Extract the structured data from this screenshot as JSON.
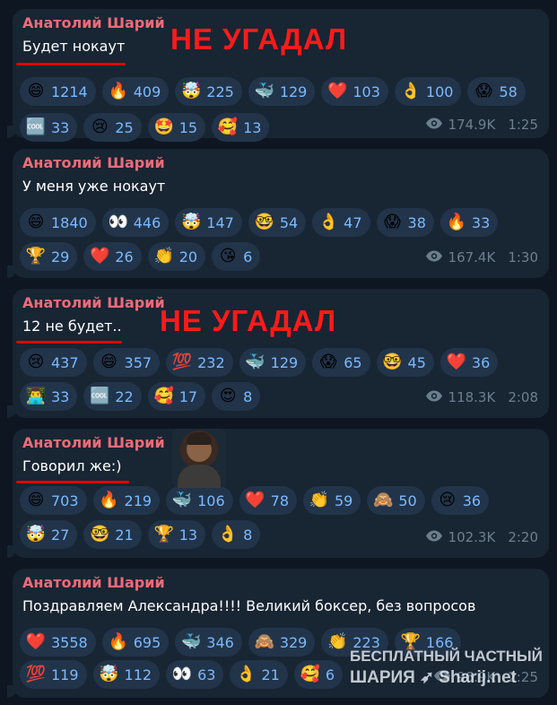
{
  "messages": [
    {
      "sender": "Анатолий Шарий",
      "text": "Будет нокаут",
      "annotation": "НЕ УГАДАЛ",
      "reactions": [
        [
          {
            "emoji": "😄",
            "count": "1214"
          },
          {
            "emoji": "🔥",
            "count": "409"
          },
          {
            "emoji": "🤯",
            "count": "225"
          },
          {
            "emoji": "🐳",
            "count": "129"
          },
          {
            "emoji": "❤️",
            "count": "103"
          },
          {
            "emoji": "👌",
            "count": "100"
          },
          {
            "emoji": "😱",
            "count": "58"
          }
        ],
        [
          {
            "emoji": "🆒",
            "count": "33"
          },
          {
            "emoji": "😢",
            "count": "25"
          },
          {
            "emoji": "🤩",
            "count": "15"
          },
          {
            "emoji": "🥰",
            "count": "13"
          }
        ]
      ],
      "views": "174.9K",
      "time": "1:25"
    },
    {
      "sender": "Анатолий Шарий",
      "text": "У меня уже нокаут",
      "reactions": [
        [
          {
            "emoji": "😄",
            "count": "1840"
          },
          {
            "emoji": "👀",
            "count": "446"
          },
          {
            "emoji": "🤯",
            "count": "147"
          },
          {
            "emoji": "🤓",
            "count": "54"
          },
          {
            "emoji": "👌",
            "count": "47"
          },
          {
            "emoji": "😱",
            "count": "38"
          },
          {
            "emoji": "🔥",
            "count": "33"
          }
        ],
        [
          {
            "emoji": "🏆",
            "count": "29"
          },
          {
            "emoji": "❤️",
            "count": "26"
          },
          {
            "emoji": "👏",
            "count": "20"
          },
          {
            "emoji": "😘",
            "count": "6"
          }
        ]
      ],
      "views": "167.4K",
      "time": "1:30"
    },
    {
      "sender": "Анатолий Шарий",
      "text": "12 не будет..",
      "annotation": "НЕ УГАДАЛ",
      "reactions": [
        [
          {
            "emoji": "😢",
            "count": "437"
          },
          {
            "emoji": "😄",
            "count": "357"
          },
          {
            "emoji": "💯",
            "count": "232"
          },
          {
            "emoji": "🐳",
            "count": "129"
          },
          {
            "emoji": "😱",
            "count": "65"
          },
          {
            "emoji": "🤓",
            "count": "45"
          },
          {
            "emoji": "❤️",
            "count": "36"
          }
        ],
        [
          {
            "emoji": "👨‍💻",
            "count": "33"
          },
          {
            "emoji": "🆒",
            "count": "22"
          },
          {
            "emoji": "🥰",
            "count": "17"
          },
          {
            "emoji": "😍",
            "count": "8"
          }
        ]
      ],
      "views": "118.3K",
      "time": "2:08"
    },
    {
      "sender": "Анатолий Шарий",
      "text": "Говорил же:)",
      "reactions": [
        [
          {
            "emoji": "😄",
            "count": "703"
          },
          {
            "emoji": "🔥",
            "count": "219"
          },
          {
            "emoji": "🐳",
            "count": "106"
          },
          {
            "emoji": "❤️",
            "count": "78"
          },
          {
            "emoji": "👏",
            "count": "59"
          },
          {
            "emoji": "🙈",
            "count": "50"
          },
          {
            "emoji": "😢",
            "count": "36"
          }
        ],
        [
          {
            "emoji": "🤯",
            "count": "27"
          },
          {
            "emoji": "🤓",
            "count": "21"
          },
          {
            "emoji": "🏆",
            "count": "13"
          },
          {
            "emoji": "👌",
            "count": "8"
          }
        ]
      ],
      "views": "102.3K",
      "time": "2:20"
    },
    {
      "sender": "Анатолий Шарий",
      "text": "Поздравляем Александра!!!! Великий боксер, без вопросов",
      "reactions": [
        [
          {
            "emoji": "❤️",
            "count": "3558"
          },
          {
            "emoji": "🔥",
            "count": "695"
          },
          {
            "emoji": "🐳",
            "count": "346"
          },
          {
            "emoji": "🙈",
            "count": "329"
          },
          {
            "emoji": "👏",
            "count": "223"
          },
          {
            "emoji": "🏆",
            "count": "166"
          }
        ],
        [
          {
            "emoji": "💯",
            "count": "119"
          },
          {
            "emoji": "🤯",
            "count": "112"
          },
          {
            "emoji": "👀",
            "count": "63"
          },
          {
            "emoji": "👌",
            "count": "21"
          },
          {
            "emoji": "🥰",
            "count": "6"
          }
        ]
      ],
      "views": "96.9K",
      "time": "2:25"
    }
  ],
  "watermark": {
    "line1": "БЕСПЛАТНЫЙ ЧАСТНЫЙ",
    "line2": "ШАРИЯ ➶ Sharij.net"
  },
  "colors": {
    "background": "#0e1621",
    "bubble": "#182533",
    "sender": "#ee6b78",
    "reaction_count": "#7bbaff",
    "annotation": "#ff1a1a"
  }
}
